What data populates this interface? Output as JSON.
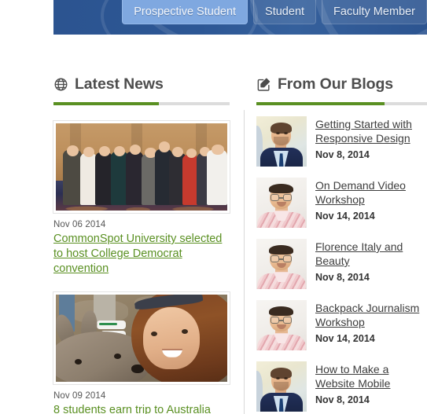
{
  "banner": {
    "audience_buttons": [
      {
        "label": "Prospective Student",
        "active": true
      },
      {
        "label": "Student",
        "active": false
      },
      {
        "label": "Faculty Member",
        "active": false
      }
    ],
    "background_color": "#2c5490",
    "active_button_color": "#7fa8e0"
  },
  "news": {
    "heading": "Latest News",
    "icon": "globe-icon",
    "accent_color": "#5a9022",
    "link_color": "#5a9022",
    "items": [
      {
        "date": "Nov 06 2014",
        "title": "CommonSpot University selected to host College Democrat convention",
        "image_alt": "group-photo-of-students-in-formal-attire"
      },
      {
        "date": "Nov 09 2014",
        "title": "8 students earn trip to Australia",
        "image_alt": "student-selfie-with-kangaroo"
      }
    ]
  },
  "blogs": {
    "heading": "From Our Blogs",
    "icon": "compose-pencil-icon",
    "accent_color": "#5a9022",
    "link_color": "#3d3d3d",
    "items": [
      {
        "title": "Getting Started with Responsive Design",
        "date": "Nov 8, 2014",
        "avatar_alt": "man-in-navy-suit-with-blue-tie",
        "avatar_style": "pa"
      },
      {
        "title": "On Demand Video Workshop",
        "date": "Nov 14, 2014",
        "avatar_alt": "man-with-glasses-in-pink-striped-shirt",
        "avatar_style": "pb"
      },
      {
        "title": "Florence Italy and Beauty",
        "date": "Nov 8, 2014",
        "avatar_alt": "man-with-glasses-in-pink-striped-shirt",
        "avatar_style": "pb"
      },
      {
        "title": "Backpack Journalism Workshop",
        "date": "Nov 14, 2014",
        "avatar_alt": "man-with-glasses-in-pink-striped-shirt",
        "avatar_style": "pb"
      },
      {
        "title": "How to Make a Website Mobile",
        "date": "Nov 8, 2014",
        "avatar_alt": "man-in-navy-suit-with-blue-tie",
        "avatar_style": "pa"
      }
    ]
  }
}
